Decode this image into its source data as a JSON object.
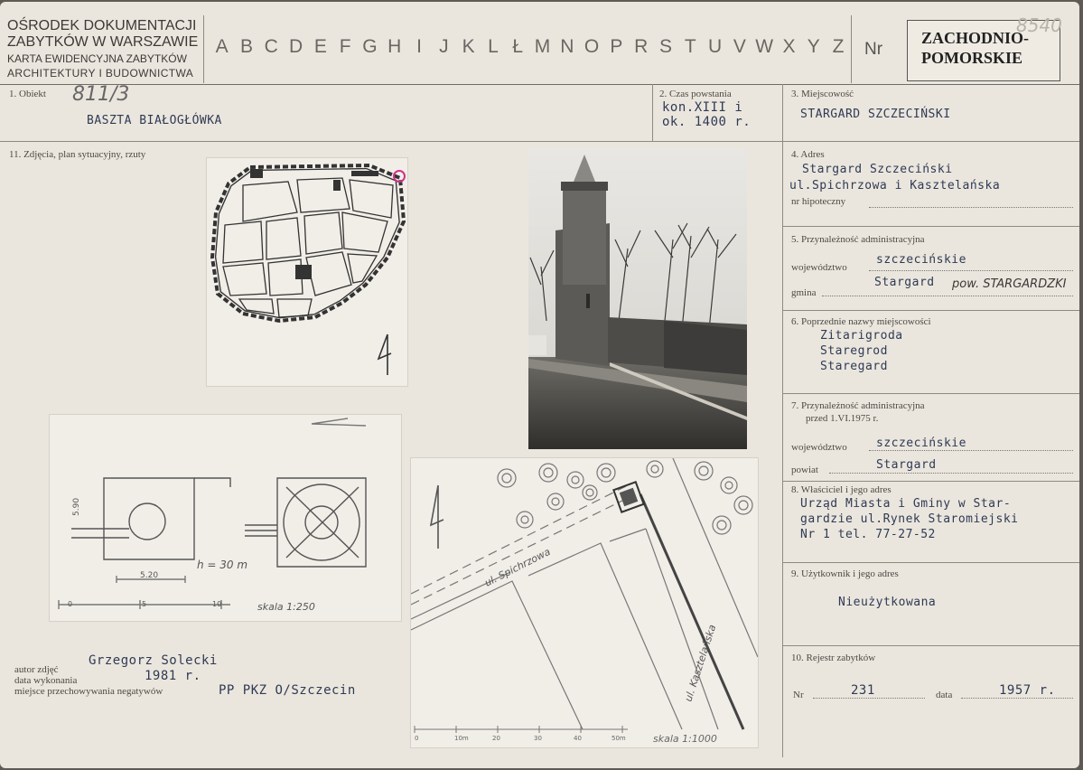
{
  "header": {
    "org_line1": "OŚRODEK DOKUMENTACJI",
    "org_line2": "ZABYTKÓW W WARSZAWIE",
    "org_line3": "KARTA EWIDENCYJNA ZABYTKÓW",
    "org_line4": "ARCHITEKTURY I BUDOWNICTWA",
    "letters": [
      "A",
      "B",
      "C",
      "D",
      "E",
      "F",
      "G",
      "H",
      "I",
      "J",
      "K",
      "L",
      "Ł",
      "M",
      "N",
      "O",
      "P",
      "R",
      "S",
      "T",
      "U",
      "V",
      "W",
      "X",
      "Y",
      "Z"
    ],
    "nr_label": "Nr",
    "region_line1": "ZACHODNIO-",
    "region_line2": "POMORSKIE",
    "stamp_number": "8540"
  },
  "fields": {
    "obiekt_label": "1. Obiekt",
    "obiekt_number": "811/3",
    "obiekt_value": "BASZTA BIAŁOGŁÓWKA",
    "czas_label": "2. Czas powstania",
    "czas_line1": "kon.XIII i",
    "czas_line2": "ok. 1400 r.",
    "miejscowosc_label": "3. Miejscowość",
    "miejscowosc_value": "STARGARD SZCZECIŃSKI",
    "zdjecia_label": "11. Zdjęcia, plan sytuacyjny, rzuty",
    "adres_label": "4. Adres",
    "adres_line1": "Stargard Szczeciński",
    "adres_line2": "ul.Spichrzowa i Kasztelańska",
    "hipoteczny_label": "nr hipoteczny",
    "przynaleznosc_label": "5. Przynależność administracyjna",
    "wojewodztwo_label": "województwo",
    "wojewodztwo_value": "szczecińskie",
    "gmina_label": "gmina",
    "gmina_value": "Stargard",
    "gmina_handwritten": "pow. STARGARDZKI",
    "poprzednie_label": "6. Poprzednie nazwy miejscowości",
    "poprzednie": [
      "Zitarigroda",
      "Staregrod",
      "Staregard"
    ],
    "przynaleznosc_old_label1": "7. Przynależność administracyjna",
    "przynaleznosc_old_label2": "przed 1.VI.1975 r.",
    "wojewodztwo_old_label": "województwo",
    "wojewodztwo_old_value": "szczecińskie",
    "powiat_label": "powiat",
    "powiat_value": "Stargard",
    "wlasciciel_label": "8. Właściciel i jego adres",
    "wlasciciel_line1": "Urząd Miasta i Gminy w Star-",
    "wlasciciel_line2": "gardzie ul.Rynek Staromiejski",
    "wlasciciel_line3": "Nr 1 tel. 77-27-52",
    "uzytkownik_label": "9. Użytkownik i jego adres",
    "uzytkownik_value": "Nieużytkowana",
    "rejestr_label": "10. Rejestr zabytków",
    "rejestr_nr_label": "Nr",
    "rejestr_nr_value": "231",
    "rejestr_data_label": "data",
    "rejestr_data_value": "1957 r.",
    "autor_label": "autor zdjęć",
    "autor_value": "Grzegorz Solecki",
    "data_label": "data wykonania",
    "data_value": "1981 r.",
    "miejsce_label": "miejsce przechowywania negatywów",
    "miejsce_value": "PP PKZ O/Szczecin"
  },
  "drawings": {
    "plan_height_label": "h = 30 m",
    "plan_dim_vertical": "5.90",
    "plan_dim_horizontal": "5.20",
    "plan_scale_ticks": [
      "0",
      "5",
      "10"
    ],
    "plan_scale_label": "skala 1:250",
    "site_street1": "ul. Spichrzowa",
    "site_street2": "ul. Kasztelańska",
    "site_scale_ticks": [
      "0",
      "10m",
      "20",
      "30",
      "40",
      "50m"
    ],
    "site_scale_label": "skala 1:1000"
  },
  "colors": {
    "paper": "#ebe6dd",
    "typewriter_ink": "#2e3a55",
    "marker_pink": "#d0308a"
  }
}
